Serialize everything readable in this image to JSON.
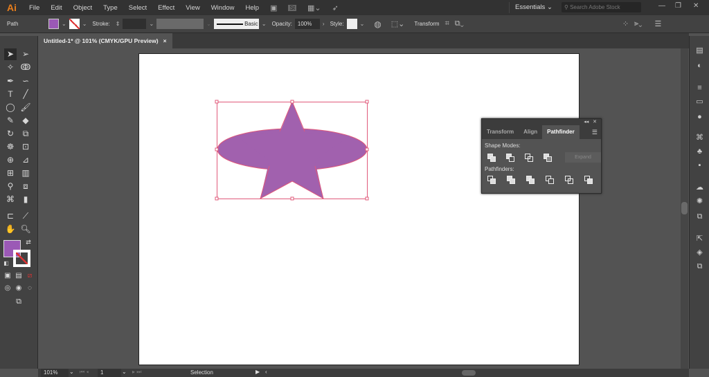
{
  "app": {
    "logo": "Ai"
  },
  "menu": [
    "File",
    "Edit",
    "Object",
    "Type",
    "Select",
    "Effect",
    "View",
    "Window",
    "Help"
  ],
  "menu_icons": [
    "bridge-icon",
    "stock-icon",
    "arrange-documents-icon",
    "gpu-rocket-icon"
  ],
  "workspace": "Essentials",
  "search_placeholder": "Search Adobe Stock",
  "control": {
    "selection_type": "Path",
    "stroke_label": "Stroke:",
    "brush_label": "Basic",
    "opacity_label": "Opacity:",
    "opacity_value": "100%",
    "style_label": "Style:",
    "transform_label": "Transform",
    "fill_color": "#9b59b6"
  },
  "document_tab": {
    "title": "Untitled-1* @ 101% (CMYK/GPU Preview)",
    "close": "×"
  },
  "panel": {
    "tabs": [
      "Transform",
      "Align",
      "Pathfinder"
    ],
    "active_tab": "Pathfinder",
    "shape_modes_label": "Shape Modes:",
    "expand_label": "Expand",
    "pathfinders_label": "Pathfinders:"
  },
  "status": {
    "zoom": "101%",
    "artboard": "1",
    "tool": "Selection"
  },
  "colors": {
    "shape_fill": "#a161ae",
    "selection": "#e0587a",
    "accent": "#e87e1c"
  }
}
